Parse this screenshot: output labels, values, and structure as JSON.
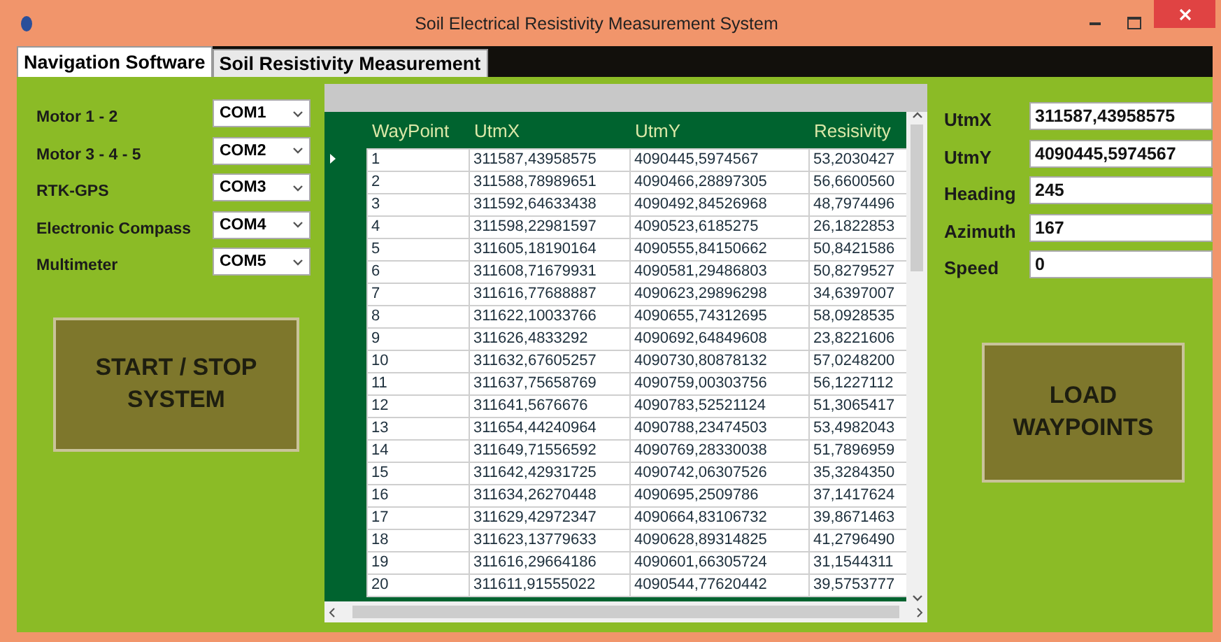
{
  "window": {
    "title": "Soil Electrical Resistivity Measurement System"
  },
  "tabs": [
    {
      "label": "Navigation Software",
      "selected": true
    },
    {
      "label": "Soil Resistivity Measurement",
      "selected": false
    }
  ],
  "ports": [
    {
      "label": "Motor 1 - 2",
      "value": "COM1"
    },
    {
      "label": "Motor 3 - 4 - 5",
      "value": "COM2"
    },
    {
      "label": "RTK-GPS",
      "value": "COM3"
    },
    {
      "label": "Electronic Compass",
      "value": "COM4"
    },
    {
      "label": "Multimeter",
      "value": "COM5"
    }
  ],
  "start_button": "START / STOP SYSTEM",
  "table": {
    "columns": [
      "WayPoint",
      "UtmX",
      "UtmY",
      "Resisivity"
    ],
    "rows": [
      {
        "selected": true,
        "cells": [
          "1",
          "311587,43958575",
          "4090445,5974567",
          "53,2030427"
        ]
      },
      {
        "selected": false,
        "cells": [
          "2",
          "311588,78989651",
          "4090466,28897305",
          "56,6600560"
        ]
      },
      {
        "selected": false,
        "cells": [
          "3",
          "311592,64633438",
          "4090492,84526968",
          "48,7974496"
        ]
      },
      {
        "selected": false,
        "cells": [
          "4",
          "311598,22981597",
          "4090523,6185275",
          "26,1822853"
        ]
      },
      {
        "selected": false,
        "cells": [
          "5",
          "311605,18190164",
          "4090555,84150662",
          "50,8421586"
        ]
      },
      {
        "selected": false,
        "cells": [
          "6",
          "311608,71679931",
          "4090581,29486803",
          "50,8279527"
        ]
      },
      {
        "selected": false,
        "cells": [
          "7",
          "311616,77688887",
          "4090623,29896298",
          "34,6397007"
        ]
      },
      {
        "selected": false,
        "cells": [
          "8",
          "311622,10033766",
          "4090655,74312695",
          "58,0928535"
        ]
      },
      {
        "selected": false,
        "cells": [
          "9",
          "311626,4833292",
          "4090692,64849608",
          "23,8221606"
        ]
      },
      {
        "selected": false,
        "cells": [
          "10",
          "311632,67605257",
          "4090730,80878132",
          "57,0248200"
        ]
      },
      {
        "selected": false,
        "cells": [
          "11",
          "311637,75658769",
          "4090759,00303756",
          "56,1227112"
        ]
      },
      {
        "selected": false,
        "cells": [
          "12",
          "311641,5676676",
          "4090783,52521124",
          "51,3065417"
        ]
      },
      {
        "selected": false,
        "cells": [
          "13",
          "311654,44240964",
          "4090788,23474503",
          "53,4982043"
        ]
      },
      {
        "selected": false,
        "cells": [
          "14",
          "311649,71556592",
          "4090769,28330038",
          "51,7896959"
        ]
      },
      {
        "selected": false,
        "cells": [
          "15",
          "311642,42931725",
          "4090742,06307526",
          "35,3284350"
        ]
      },
      {
        "selected": false,
        "cells": [
          "16",
          "311634,26270448",
          "4090695,2509786",
          "37,1417624"
        ]
      },
      {
        "selected": false,
        "cells": [
          "17",
          "311629,42972347",
          "4090664,83106732",
          "39,8671463"
        ]
      },
      {
        "selected": false,
        "cells": [
          "18",
          "311623,13779633",
          "4090628,89314825",
          "41,2796490"
        ]
      },
      {
        "selected": false,
        "cells": [
          "19",
          "311616,29664186",
          "4090601,66305724",
          "31,1544311"
        ]
      },
      {
        "selected": false,
        "cells": [
          "20",
          "311611,91555022",
          "4090544,77620442",
          "39,5753777"
        ]
      }
    ]
  },
  "readouts": [
    {
      "label": "UtmX",
      "value": "311587,43958575"
    },
    {
      "label": "UtmY",
      "value": "4090445,5974567"
    },
    {
      "label": "Heading",
      "value": "245"
    },
    {
      "label": "Azimuth",
      "value": "167"
    },
    {
      "label": "Speed",
      "value": "0"
    }
  ],
  "load_button": "LOAD WAYPOINTS"
}
